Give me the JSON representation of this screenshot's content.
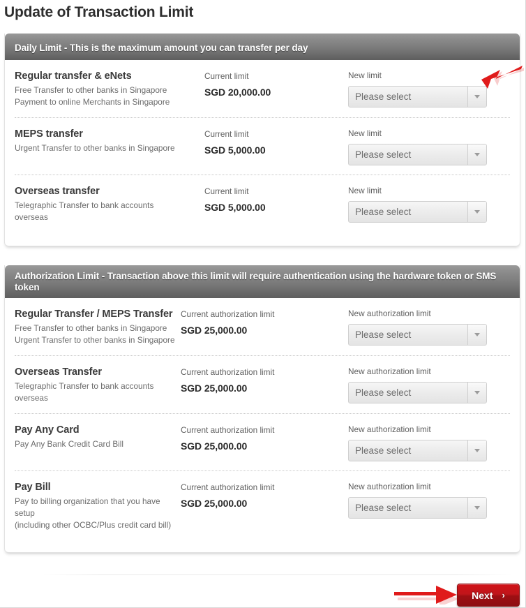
{
  "page": {
    "title": "Update of Transaction Limit"
  },
  "panels": [
    {
      "id": "daily-limit",
      "header": "Daily Limit - This is the maximum amount you can transfer per day",
      "rows": [
        {
          "title": "Regular transfer & eNets",
          "descriptions": [
            "Free Transfer to other banks in Singapore",
            "Payment to online Merchants in Singapore"
          ],
          "current_label": "Current limit",
          "current_value": "SGD 20,000.00",
          "new_label": "New limit",
          "select_value": "Please select"
        },
        {
          "title": "MEPS transfer",
          "descriptions": [
            "Urgent Transfer to other banks in Singapore"
          ],
          "current_label": "Current limit",
          "current_value": "SGD 5,000.00",
          "new_label": "New limit",
          "select_value": "Please select"
        },
        {
          "title": "Overseas transfer",
          "descriptions": [
            "Telegraphic Transfer to bank accounts",
            "overseas"
          ],
          "current_label": "Current limit",
          "current_value": "SGD 5,000.00",
          "new_label": "New limit",
          "select_value": "Please select"
        }
      ]
    },
    {
      "id": "authorization-limit",
      "header": "Authorization Limit - Transaction above this limit will require authentication using the hardware token or SMS token",
      "rows": [
        {
          "title": "Regular Transfer / MEPS Transfer",
          "descriptions": [
            "Free Transfer to other banks in Singapore",
            "Urgent Transfer to other banks in Singapore"
          ],
          "current_label": "Current authorization limit",
          "current_value": "SGD 25,000.00",
          "new_label": "New authorization limit",
          "select_value": "Please select"
        },
        {
          "title": "Overseas Transfer",
          "descriptions": [
            "Telegraphic Transfer to bank accounts",
            "overseas"
          ],
          "current_label": "Current authorization limit",
          "current_value": "SGD 25,000.00",
          "new_label": "New authorization limit",
          "select_value": "Please select"
        },
        {
          "title": "Pay Any Card",
          "descriptions": [
            "Pay Any Bank Credit Card Bill"
          ],
          "current_label": "Current authorization limit",
          "current_value": "SGD 25,000.00",
          "new_label": "New authorization limit",
          "select_value": "Please select"
        },
        {
          "title": "Pay Bill",
          "descriptions": [
            "Pay to billing organization that you have setup",
            "(including other OCBC/Plus credit card bill)"
          ],
          "current_label": "Current authorization limit",
          "current_value": "SGD 25,000.00",
          "new_label": "New authorization limit",
          "select_value": "Please select"
        }
      ]
    }
  ],
  "footer": {
    "next_label": "Next",
    "next_chevron": "›"
  },
  "annotations": {
    "arrow_color": "#e01b1b",
    "top_arrow": "points to first New limit dropdown",
    "bottom_arrow": "points to Next button"
  },
  "icons": {
    "select_caret": "chevron-down-icon",
    "next_chevron": "chevron-right-icon"
  }
}
